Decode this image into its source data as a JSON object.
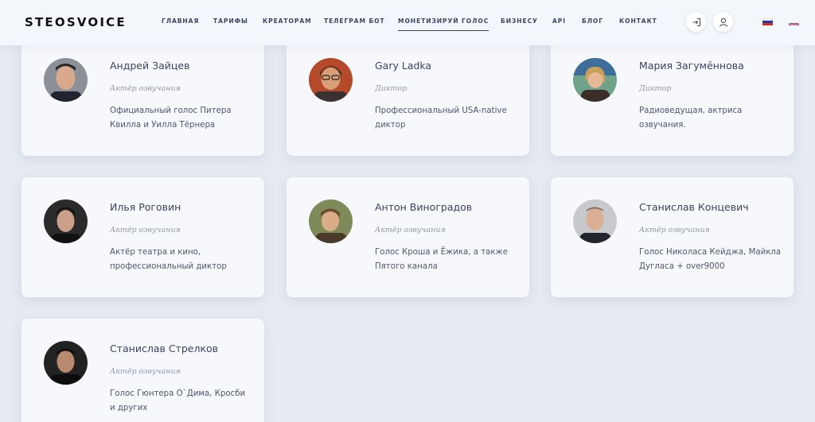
{
  "header": {
    "logo": "STEOSVOICE",
    "nav": [
      {
        "label": "ГЛАВНАЯ",
        "active": false
      },
      {
        "label": "ТАРИФЫ",
        "active": false
      },
      {
        "label": "КРЕАТОРАМ",
        "active": false
      },
      {
        "label": "ТЕЛЕГРАМ БОТ",
        "active": false
      },
      {
        "label": "МОНЕТИЗИРУЙ ГОЛОС",
        "active": true
      },
      {
        "label": "БИЗНЕСУ",
        "active": false
      },
      {
        "label": "API",
        "active": false
      },
      {
        "label": "БЛОГ",
        "active": false
      },
      {
        "label": "КОНТАКТ",
        "active": false
      }
    ]
  },
  "cards": [
    {
      "name": "Андрей Зайцев",
      "role": "Актёр озвучания",
      "desc": "Официальный голос Питера Квилла и Уилла Тёрнера"
    },
    {
      "name": "Gary Ladka",
      "role": "Диктор",
      "desc": "Профессиональный USA-native диктор"
    },
    {
      "name": "Мария Загумённова",
      "role": "Диктор",
      "desc": "Радиоведущая, актриса озвучания."
    },
    {
      "name": "Илья Роговин",
      "role": "Актёр озвучания",
      "desc": "Актёр театра и кино, профессиональный диктор"
    },
    {
      "name": "Антон Виноградов",
      "role": "Актёр озвучания",
      "desc": "Голос Кроша и Ёжика, а также Пятого канала"
    },
    {
      "name": "Станислав Концевич",
      "role": "Актёр озвучания",
      "desc": "Голос Николаса Кейджа, Майкла Дугласа + over9000"
    },
    {
      "name": "Станислав Стрелков",
      "role": "Актёр озвучания",
      "desc": "Голос Гюнтера О`Дима, Кросби и других"
    }
  ],
  "colors": {
    "background": "#e6eaf1",
    "card": "#f6f8fb",
    "text": "#3a4460",
    "muted": "#9097a8"
  }
}
